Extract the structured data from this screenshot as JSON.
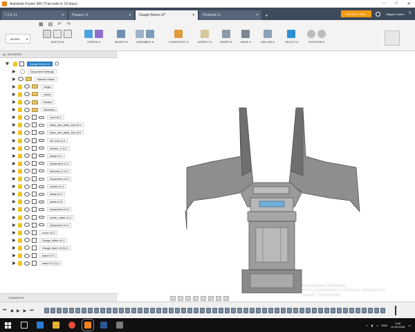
{
  "window": {
    "title": "Autodesk Fusion 360 (Trial ends in 19 days)"
  },
  "tabs": [
    {
      "label": "Γ.Σ.Ε v1",
      "active": false
    },
    {
      "label": "Ραμφος ν1",
      "active": false
    },
    {
      "label": "Gauge fixture v2*",
      "active": true
    },
    {
      "label": "Pedestal v1",
      "active": false
    }
  ],
  "header": {
    "extend_label": "EXTEND TRIAL",
    "user": "Вадим Сапега"
  },
  "toolbar": {
    "workspace": "MODEL",
    "groups": [
      {
        "label": "SKETCH ▾"
      },
      {
        "label": "CREATE ▾"
      },
      {
        "label": "MODIFY ▾"
      },
      {
        "label": "ASSEMBLE ▾"
      },
      {
        "label": "CONSTRUCT ▾"
      },
      {
        "label": "INSPECT ▾"
      },
      {
        "label": "INSERT ▾"
      },
      {
        "label": "MAKE ▾"
      },
      {
        "label": "ADD-INS ▾"
      },
      {
        "label": "SELECT ▾"
      },
      {
        "label": "POSITION ▾"
      }
    ]
  },
  "browser": {
    "header": "BROWSER",
    "root": "Gauge fixture v2",
    "items": [
      {
        "label": "Document Settings",
        "icon": "gear-icon"
      },
      {
        "label": "Named Views",
        "icon": "folder-icon"
      },
      {
        "label": "Origin",
        "icon": "folder-icon"
      },
      {
        "label": "Joints",
        "icon": "folder-icon"
      },
      {
        "label": "Bodies",
        "icon": "folder-icon"
      },
      {
        "label": "Sketches",
        "icon": "folder-icon"
      },
      {
        "label": "nord v9:1",
        "icon": "link-icon"
      },
      {
        "label": "base_hub_table_link v3:1",
        "icon": "link-icon"
      },
      {
        "label": "base_hub_table_link v3:2",
        "icon": "link-icon"
      },
      {
        "label": "NX-12A v1:1",
        "icon": "link-icon"
      },
      {
        "label": "ebnsel_1 v1:1",
        "icon": "link-icon"
      },
      {
        "label": "detail v1:1",
        "icon": "link-icon"
      },
      {
        "label": "Dynamixel v1:1",
        "icon": "link-icon"
      },
      {
        "label": "element_2 v1:1",
        "icon": "link-icon"
      },
      {
        "label": "Dynamixel v1:2",
        "icon": "link-icon"
      },
      {
        "label": "socket v1:1",
        "icon": "link-icon"
      },
      {
        "label": "detail v1:2",
        "icon": "link-icon"
      },
      {
        "label": "detail v1:3",
        "icon": "link-icon"
      },
      {
        "label": "Dynamixel v1:3",
        "icon": "link-icon"
      },
      {
        "label": "nortel_rotate v1:1",
        "icon": "link-icon"
      },
      {
        "label": "Dynamixel v1:4",
        "icon": "link-icon"
      },
      {
        "label": "cover v2:1",
        "icon": "box-icon"
      },
      {
        "label": "Gauge_slider v1:1",
        "icon": "box-icon"
      },
      {
        "label": "Gauge_laser v3 (1):1",
        "icon": "box-icon"
      },
      {
        "label": "insert v7:1",
        "icon": "box-icon"
      },
      {
        "label": "insert v7 (1):1",
        "icon": "box-icon"
      }
    ]
  },
  "comments": {
    "label": "COMMENTS"
  },
  "watermark": {
    "line1": "Активация Windows",
    "line2": "Чтобы активировать Windows, перейдите в",
    "line3": "раздел \"Параметры\"."
  },
  "taskbar": {
    "lang": "ENG",
    "time": "2:59",
    "date": "21.09.2018"
  },
  "colors": {
    "tab_bar": "#3c4a5a",
    "accent": "#f39c12",
    "selection": "#2a7fc0",
    "model_gray": "#8e8e8e"
  }
}
